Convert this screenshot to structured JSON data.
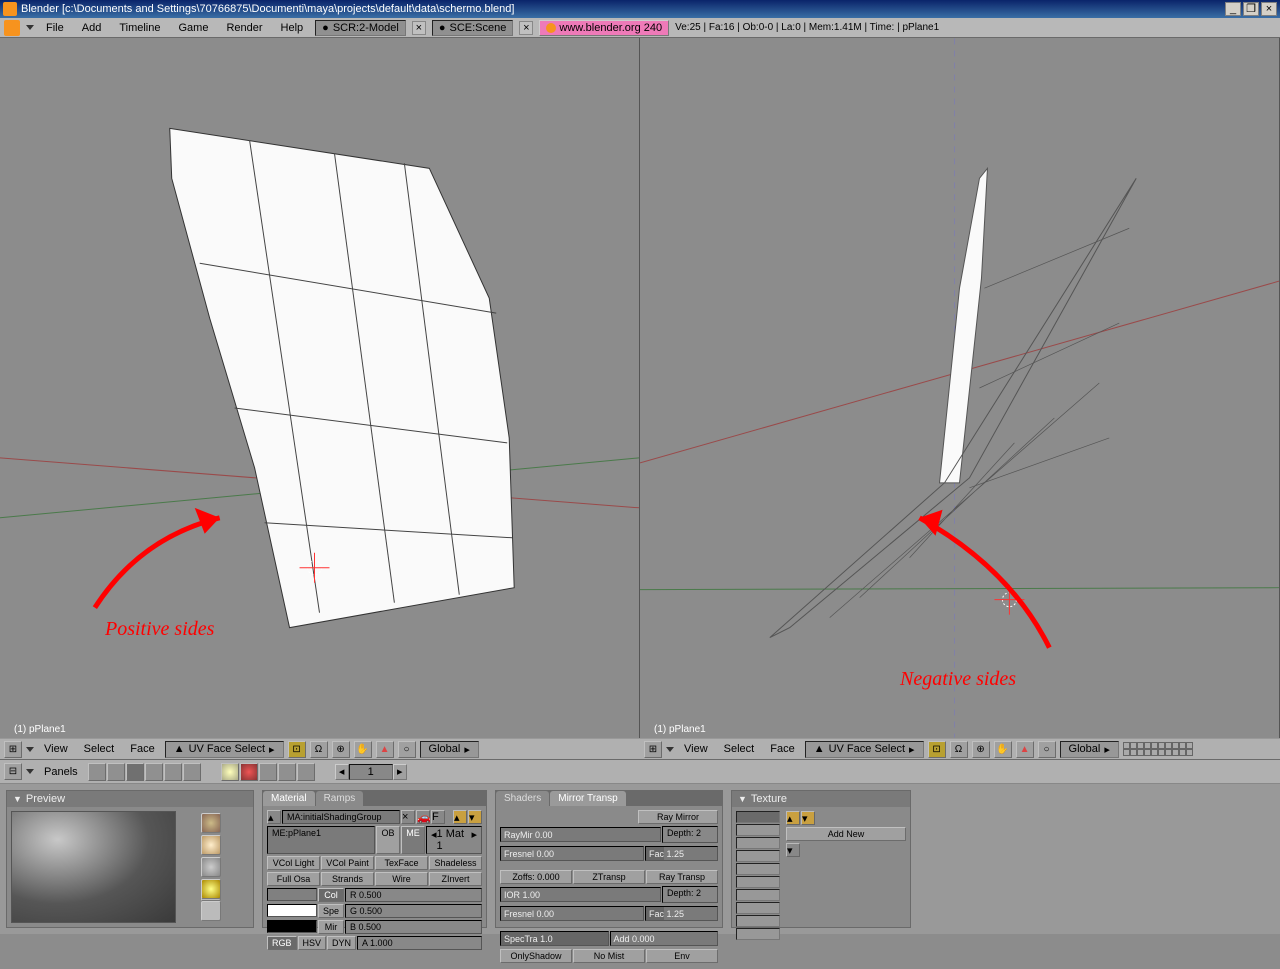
{
  "title": "Blender [c:\\Documents and Settings\\70766875\\Documenti\\maya\\projects\\default\\data\\schermo.blend]",
  "menus": {
    "file": "File",
    "add": "Add",
    "timeline": "Timeline",
    "game": "Game",
    "render": "Render",
    "help": "Help"
  },
  "scr": "SCR:2-Model",
  "sce": "SCE:Scene",
  "link": "www.blender.org 240",
  "stats": "Ve:25 | Fa:16 | Ob:0-0 | La:0 | Mem:1.41M | Time:  | pPlane1",
  "vp_label": "(1) pPlane1",
  "left_annot": "Positive sides",
  "right_annot": "Negative sides",
  "view_menu": {
    "view": "View",
    "select": "Select",
    "face": "Face"
  },
  "mode": "UV Face Select",
  "orient": "Global",
  "panels": "Panels",
  "frame": "1",
  "preview": "Preview",
  "material_tab": "Material",
  "ramps_tab": "Ramps",
  "shaders_tab": "Shaders",
  "mirror_tab": "Mirror Transp",
  "texture_tab": "Texture",
  "mat_link": "MA:initialShadingGroup",
  "me_link": "ME:pPlane1",
  "ob": "OB",
  "me": "ME",
  "mat_count": "1 Mat 1",
  "vcol_light": "VCol Light",
  "vcol_paint": "VCol Paint",
  "texface": "TexFace",
  "shadeless": "Shadeless",
  "full_osa": "Full Osa",
  "strands": "Strands",
  "wire": "Wire",
  "zinvert": "ZInvert",
  "col": "Col",
  "spe": "Spe",
  "mir": "Mir",
  "rgb": "RGB",
  "hsv": "HSV",
  "dyn": "DYN",
  "r": "R 0.500",
  "g": "G 0.500",
  "b": "B 0.500",
  "a": "A 1.000",
  "raymir": "RayMir 0.00",
  "depth": "Depth: 2",
  "fresnel": "Fresnel 0.00",
  "fac": "Fac 1.25",
  "zoffs": "Zoffs: 0.000",
  "ztransp": "ZTransp",
  "ray_transp": "Ray Transp",
  "ray_mirror": "Ray Mirror",
  "ior": "IOR 1.00",
  "depth2": "Depth: 2",
  "fresnel2": "Fresnel 0.00",
  "fac2": "Fac 1.25",
  "spectra": "SpecTra 1.0",
  "add": "Add 0.000",
  "only_shadow": "OnlyShadow",
  "no_mist": "No Mist",
  "env": "Env",
  "add_new": "Add New"
}
